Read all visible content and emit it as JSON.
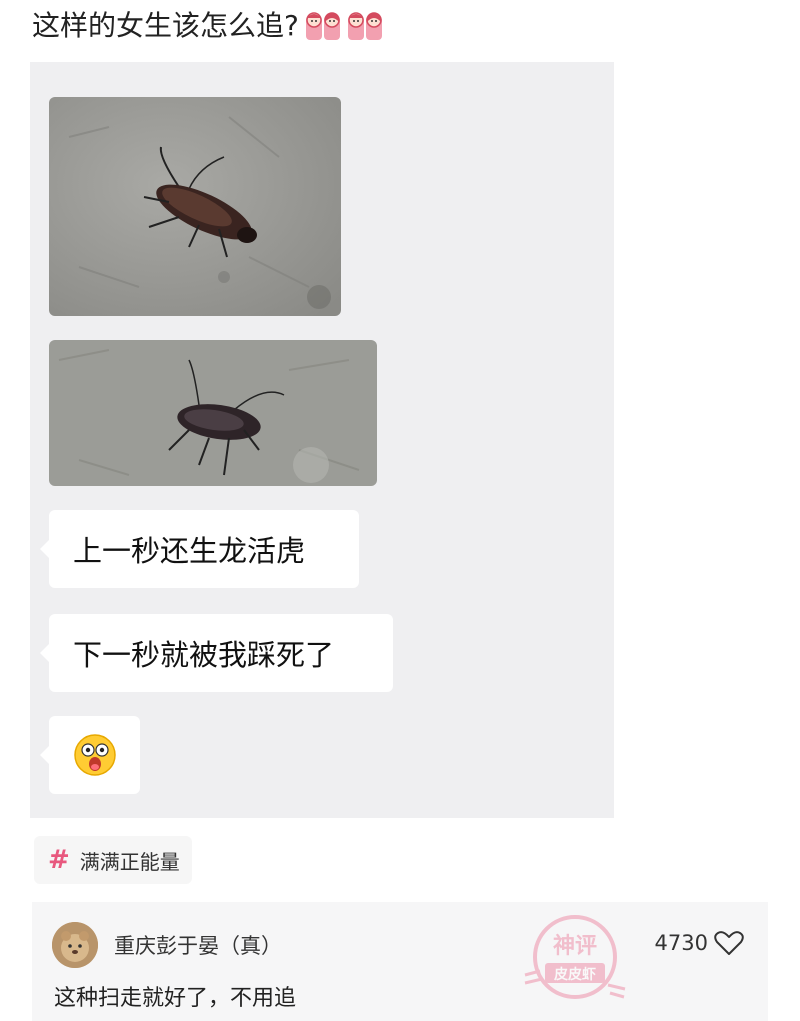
{
  "post": {
    "title": "这样的女生该怎么追?",
    "title_emojis": [
      "couple-emoji",
      "couple-emoji"
    ]
  },
  "chat": {
    "images": [
      {
        "icon": "cockroach-photo"
      },
      {
        "icon": "cockroach-photo"
      }
    ],
    "messages": [
      {
        "text": "上一秒还生龙活虎"
      },
      {
        "text": "下一秒就被我踩死了"
      },
      {
        "icon": "shocked-face-emoji"
      }
    ]
  },
  "tag": {
    "symbol": "#",
    "label": "满满正能量"
  },
  "comment": {
    "author": "重庆彭于晏（真）",
    "text": "这种扫走就好了，不用追",
    "likes": "4730",
    "like_icon": "heart-icon"
  },
  "watermark": {
    "line1": "神评",
    "line2": "皮皮虾"
  },
  "colors": {
    "accent": "#e8587e",
    "chat_bg": "#efeff1",
    "bubble_bg": "#ffffff"
  }
}
